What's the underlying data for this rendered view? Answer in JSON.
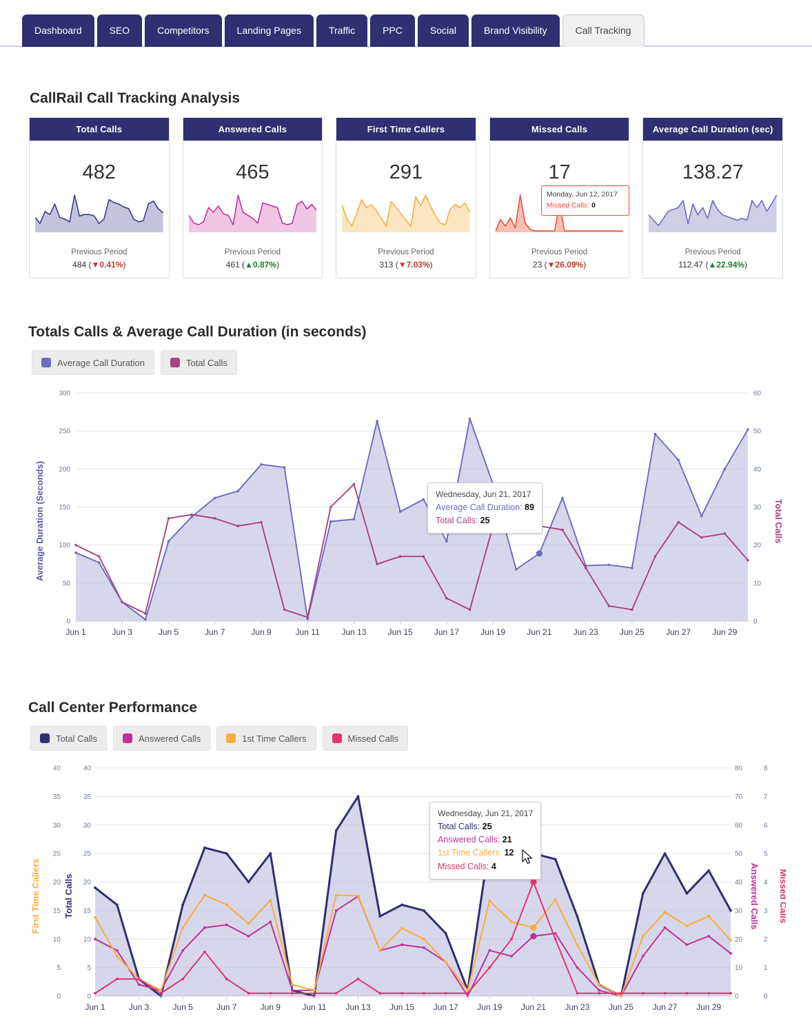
{
  "tabs": [
    {
      "label": "Dashboard",
      "active": false
    },
    {
      "label": "SEO",
      "active": false
    },
    {
      "label": "Competitors",
      "active": false
    },
    {
      "label": "Landing Pages",
      "active": false
    },
    {
      "label": "Traffic",
      "active": false
    },
    {
      "label": "PPC",
      "active": false
    },
    {
      "label": "Social",
      "active": false
    },
    {
      "label": "Brand Visibility",
      "active": false
    },
    {
      "label": "Call Tracking",
      "active": true
    }
  ],
  "headings": {
    "kpi": "CallRail Call Tracking Analysis",
    "chart1": "Totals Calls & Average Call Duration (in seconds)",
    "chart2": "Call Center Performance"
  },
  "colors": {
    "navy": "#2f2f71",
    "duration_purple": "#6b6bbf",
    "total_calls_magenta": "#a8437e",
    "answered_magenta": "#c0309b",
    "first_time_orange": "#f9ae3e",
    "missed_pink": "#e0356f",
    "missed_red": "#e8503a",
    "area_fill": "#bcbcdd"
  },
  "kpis": [
    {
      "title": "Total Calls",
      "value": "482",
      "prev_label": "Previous Period",
      "prev_value": "484",
      "delta": "0.41%",
      "direction": "down",
      "arrow": "▼",
      "spark_color": "#3b3b8f",
      "spark_fill": "#b9b9d8",
      "spark": [
        18,
        10,
        26,
        22,
        36,
        18,
        16,
        12,
        48,
        20,
        22,
        22,
        20,
        10,
        16,
        42,
        38,
        36,
        32,
        30,
        16,
        12,
        14,
        36,
        40,
        30,
        24
      ]
    },
    {
      "title": "Answered Calls",
      "value": "465",
      "prev_label": "Previous Period",
      "prev_value": "461",
      "delta": "0.87%",
      "direction": "up",
      "arrow": "▲",
      "spark_color": "#c0309b",
      "spark_fill": "#edbcdd",
      "spark": [
        20,
        10,
        8,
        12,
        30,
        24,
        32,
        22,
        20,
        8,
        46,
        24,
        20,
        16,
        10,
        36,
        34,
        32,
        30,
        10,
        8,
        10,
        34,
        38,
        28,
        34,
        26
      ]
    },
    {
      "title": "First Time Callers",
      "value": "291",
      "prev_label": "Previous Period",
      "prev_value": "313",
      "delta": "7.03%",
      "direction": "down",
      "arrow": "▼",
      "spark_color": "#f9ae3e",
      "spark_fill": "#fbe2b6",
      "spark": [
        34,
        16,
        6,
        22,
        40,
        30,
        34,
        26,
        16,
        6,
        38,
        30,
        22,
        14,
        6,
        44,
        32,
        46,
        32,
        20,
        10,
        8,
        28,
        34,
        30,
        36,
        24
      ]
    },
    {
      "title": "Missed Calls",
      "value": "17",
      "prev_label": "Previous Period",
      "prev_value": "23",
      "delta": "26.09%",
      "direction": "down",
      "arrow": "▼",
      "spark_color": "#e8503a",
      "spark_fill": "#f6b3a6",
      "spark": [
        0,
        14,
        6,
        16,
        4,
        44,
        10,
        2,
        0,
        0,
        0,
        0,
        0,
        34,
        0,
        0,
        0,
        0,
        0,
        0,
        0,
        0,
        0,
        0,
        0,
        0,
        0
      ],
      "tooltip": {
        "date": "Monday, Jun 12, 2017",
        "metric": "Missed Calls",
        "value": "0"
      }
    },
    {
      "title": "Average Call Duration (sec)",
      "value": "138.27",
      "prev_label": "Previous Period",
      "prev_value": "112.47",
      "delta": "22.94%",
      "direction": "up",
      "arrow": "▲",
      "spark_color": "#6b6bbf",
      "spark_fill": "#c5c5e2",
      "spark": [
        18,
        12,
        6,
        14,
        22,
        24,
        26,
        34,
        8,
        30,
        18,
        26,
        14,
        34,
        24,
        18,
        16,
        14,
        12,
        14,
        12,
        34,
        26,
        34,
        22,
        30,
        40
      ]
    }
  ],
  "chart1": {
    "legend": [
      {
        "label": "Average Call Duration",
        "color": "#6b6bbf"
      },
      {
        "label": "Total Calls",
        "color": "#a8437e"
      }
    ],
    "tooltip": {
      "date": "Wednesday, Jun 21, 2017",
      "rows": [
        {
          "label": "Average Call Duration",
          "value": "89",
          "color": "#6b6bbf"
        },
        {
          "label": "Total Calls",
          "value": "25",
          "color": "#a8437e"
        }
      ]
    }
  },
  "chart2": {
    "legend": [
      {
        "label": "Total Calls",
        "color": "#2f2f71"
      },
      {
        "label": "Answered Calls",
        "color": "#c0309b"
      },
      {
        "label": "1st Time Callers",
        "color": "#f9ae3e"
      },
      {
        "label": "Missed Calls",
        "color": "#e0356f"
      }
    ],
    "tooltip": {
      "date": "Wednesday, Jun 21, 2017",
      "rows": [
        {
          "label": "Total Calls",
          "value": "25",
          "color": "#2f2f71"
        },
        {
          "label": "Answered Calls",
          "value": "21",
          "color": "#c0309b"
        },
        {
          "label": "1st Time Callers",
          "value": "12",
          "color": "#f9ae3e"
        },
        {
          "label": "Missed Calls",
          "value": "4",
          "color": "#e0356f"
        }
      ]
    }
  },
  "chart_data": [
    {
      "type": "area",
      "title": "Totals Calls & Average Call Duration (in seconds)",
      "xlabel": "",
      "ylabel": "Average Duration (Seconds)",
      "y2label": "Total Calls",
      "ylim": [
        0,
        300
      ],
      "y2lim": [
        0,
        60
      ],
      "yticks": [
        0,
        50,
        100,
        150,
        200,
        250,
        300
      ],
      "y2ticks": [
        0,
        10,
        20,
        30,
        40,
        50,
        60
      ],
      "grid": true,
      "legend_position": "top-left",
      "x": [
        "Jun 1",
        "Jun 2",
        "Jun 3",
        "Jun 4",
        "Jun 5",
        "Jun 6",
        "Jun 7",
        "Jun 8",
        "Jun 9",
        "Jun 10",
        "Jun 11",
        "Jun 12",
        "Jun 13",
        "Jun 14",
        "Jun 15",
        "Jun 16",
        "Jun 17",
        "Jun 18",
        "Jun 19",
        "Jun 20",
        "Jun 21",
        "Jun 22",
        "Jun 23",
        "Jun 24",
        "Jun 25",
        "Jun 26",
        "Jun 27",
        "Jun 28",
        "Jun 29",
        "Jun 30"
      ],
      "series": [
        {
          "name": "Average Call Duration",
          "color": "#6b6bbf",
          "axis": "left",
          "units": "seconds",
          "values": [
            90,
            77,
            25,
            2,
            105,
            137,
            162,
            171,
            206,
            202,
            3,
            131,
            134,
            263,
            144,
            160,
            105,
            266,
            180,
            68,
            89,
            162,
            73,
            74,
            70,
            246,
            212,
            138,
            200,
            252
          ]
        },
        {
          "name": "Total Calls",
          "color": "#a8437e",
          "axis": "right",
          "units": "calls",
          "values": [
            20,
            17,
            5,
            2,
            27,
            28,
            27,
            25,
            26,
            3,
            1,
            30,
            36,
            15,
            17,
            17,
            6,
            3,
            25,
            26,
            25,
            24,
            14,
            4,
            3,
            17,
            26,
            22,
            23,
            16
          ]
        }
      ],
      "annotations": [
        {
          "x": "Jun 21",
          "text": "Wednesday, Jun 21, 2017 | Average Call Duration: 89 | Total Calls: 25"
        }
      ]
    },
    {
      "type": "area",
      "title": "Call Center Performance",
      "xlabel": "",
      "ylabel": "First Time Callers",
      "ylabel2": "Total Calls",
      "y2label": "Answered Calls",
      "y2label2": "Missed Calls",
      "ylim": [
        0,
        40
      ],
      "yticks": [
        0,
        5,
        10,
        15,
        20,
        25,
        30,
        35,
        40
      ],
      "y_firsttime_lim": [
        0,
        40
      ],
      "y_answered_lim": [
        0,
        80
      ],
      "y_answered_ticks": [
        0,
        10,
        20,
        30,
        40,
        50,
        60,
        70,
        80
      ],
      "y_missed_lim": [
        0,
        8
      ],
      "y_missed_ticks": [
        0,
        1,
        2,
        3,
        4,
        5,
        6,
        7,
        8
      ],
      "grid": true,
      "legend_position": "top-left",
      "x": [
        "Jun 1",
        "Jun 2",
        "Jun 3",
        "Jun 4",
        "Jun 5",
        "Jun 6",
        "Jun 7",
        "Jun 8",
        "Jun 9",
        "Jun 10",
        "Jun 11",
        "Jun 12",
        "Jun 13",
        "Jun 14",
        "Jun 15",
        "Jun 16",
        "Jun 17",
        "Jun 18",
        "Jun 19",
        "Jun 20",
        "Jun 21",
        "Jun 22",
        "Jun 23",
        "Jun 24",
        "Jun 25",
        "Jun 26",
        "Jun 27",
        "Jun 28",
        "Jun 29",
        "Jun 30"
      ],
      "series": [
        {
          "name": "Total Calls",
          "color": "#2f2f71",
          "axis": "left",
          "values": [
            19,
            16,
            3,
            0,
            16,
            26,
            25,
            20,
            25,
            1,
            0,
            29,
            35,
            14,
            16,
            15,
            11,
            1,
            27,
            25,
            25,
            24,
            14,
            2,
            0,
            18,
            25,
            18,
            22,
            15
          ]
        },
        {
          "name": "Answered Calls",
          "color": "#c0309b",
          "axis": "right",
          "values": [
            20,
            16,
            4,
            2,
            16,
            24,
            25,
            21,
            26,
            2,
            2,
            30,
            35,
            16,
            18,
            17,
            12,
            0,
            16,
            14,
            21,
            22,
            10,
            2,
            0,
            14,
            24,
            18,
            21,
            15
          ]
        },
        {
          "name": "1st Time Callers",
          "color": "#f9ae3e",
          "axis": "left",
          "values": [
            13.8,
            7,
            3,
            1,
            12,
            17.7,
            16,
            12.7,
            16.8,
            2,
            1,
            17.7,
            17.6,
            8,
            11.9,
            10,
            6,
            1,
            16.7,
            13,
            12,
            16.9,
            9,
            2,
            0,
            10.5,
            14.7,
            12.3,
            14,
            9.8
          ]
        },
        {
          "name": "Missed Calls",
          "color": "#e0356f",
          "axis": "right-missed",
          "values": [
            0.1,
            0.6,
            0.6,
            0.1,
            0.6,
            1.55,
            0.6,
            0.1,
            0.1,
            0.1,
            0.1,
            0.1,
            0.6,
            0.1,
            0.1,
            0.1,
            0.1,
            0.1,
            1.0,
            2.0,
            4.0,
            2.0,
            0.1,
            0.1,
            0.1,
            0.1,
            0.1,
            0.1,
            0.1,
            0.1
          ]
        }
      ],
      "annotations": [
        {
          "x": "Jun 21",
          "text": "Wednesday, Jun 21, 2017 | Total Calls: 25 | Answered Calls: 21 | 1st Time Callers: 12 | Missed Calls: 4"
        }
      ]
    }
  ]
}
